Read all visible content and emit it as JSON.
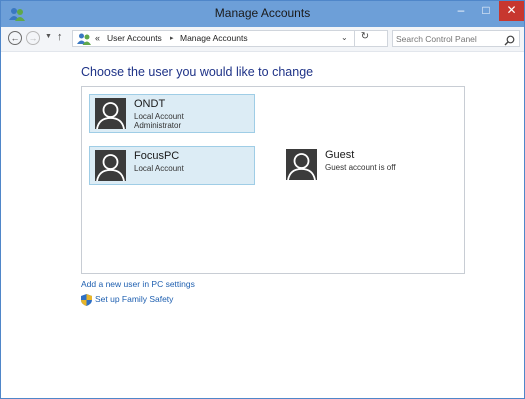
{
  "window": {
    "title": "Manage Accounts",
    "controls": {
      "minimize": "–",
      "maximize": "□",
      "close": "✕"
    }
  },
  "nav": {
    "back_icon": "back-arrow-icon",
    "forward_icon": "forward-arrow-icon",
    "up_icon": "up-arrow-icon",
    "breadcrumb_prefix": "«",
    "breadcrumb": [
      "User Accounts",
      "Manage Accounts"
    ],
    "breadcrumb_separator": "▸",
    "search_placeholder": "Search Control Panel"
  },
  "main": {
    "heading": "Choose the user you would like to change",
    "accounts": [
      {
        "name": "ONDT",
        "line1": "Local Account",
        "line2": "Administrator",
        "selected": true
      },
      {
        "name": "FocusPC",
        "line1": "Local Account",
        "line2": "",
        "selected": true
      },
      {
        "name": "Guest",
        "line1": "Guest account is off",
        "line2": "",
        "selected": false
      }
    ],
    "add_user_link": "Add a new user in PC settings",
    "family_safety_link": "Set up Family Safety"
  },
  "colors": {
    "titlebar": "#6d9fd8",
    "heading": "#1e3287",
    "link": "#1e5fb0",
    "selected_bg": "#dcecf5",
    "close_button": "#c7372f"
  }
}
